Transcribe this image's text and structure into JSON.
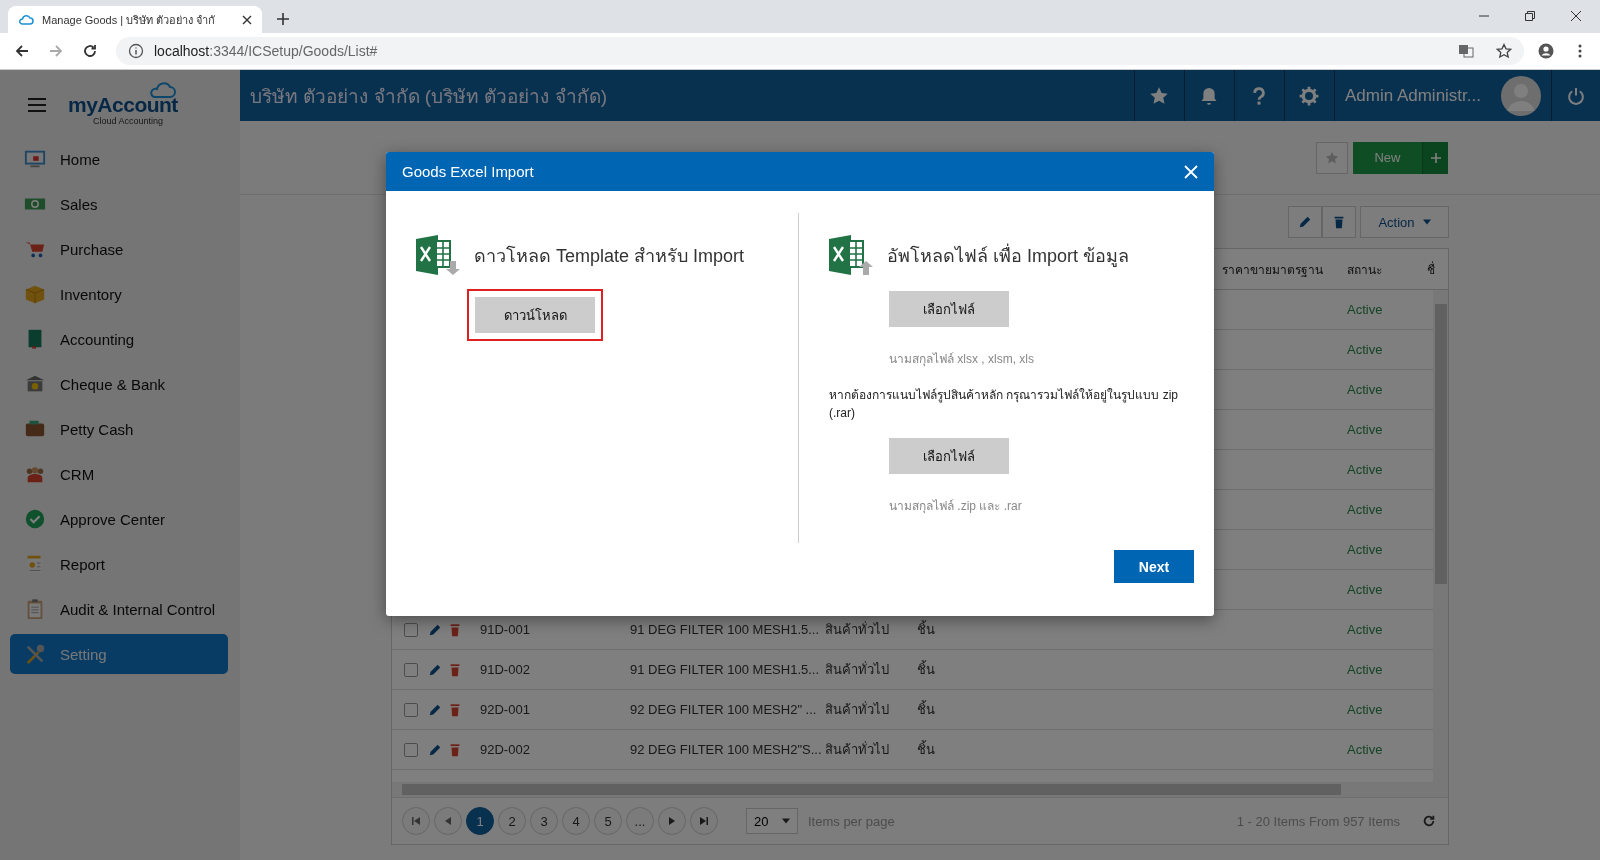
{
  "browser": {
    "tab_title": "Manage Goods | บริษัท ตัวอย่าง จำกั",
    "url_host": "localhost",
    "url_path": ":3344/ICSetup/Goods/List#"
  },
  "logo": {
    "name": "myAccount",
    "tagline": "Cloud Accounting"
  },
  "company": "บริษัท ตัวอย่าง จำกัด (บริษัท ตัวอย่าง จำกัด)",
  "user": "Admin Administr...",
  "sidebar": [
    {
      "label": "Home",
      "selected": false
    },
    {
      "label": "Sales",
      "selected": false
    },
    {
      "label": "Purchase",
      "selected": false
    },
    {
      "label": "Inventory",
      "selected": false
    },
    {
      "label": "Accounting",
      "selected": false
    },
    {
      "label": "Cheque & Bank",
      "selected": false
    },
    {
      "label": "Petty Cash",
      "selected": false
    },
    {
      "label": "CRM",
      "selected": false
    },
    {
      "label": "Approve Center",
      "selected": false
    },
    {
      "label": "Report",
      "selected": false
    },
    {
      "label": "Audit & Internal Control",
      "selected": false
    },
    {
      "label": "Setting",
      "selected": true
    }
  ],
  "toolbar": {
    "new": "New",
    "action": "Action"
  },
  "table": {
    "columns": [
      "ราคาขายมาตรฐาน",
      "สถานะ",
      "ชื่"
    ],
    "rows": [
      {
        "status": "Active"
      },
      {
        "status": "Active"
      },
      {
        "status": "Active"
      },
      {
        "status": "Active"
      },
      {
        "status": "Active"
      },
      {
        "status": "Active"
      },
      {
        "status": "Active"
      },
      {
        "status": "Active"
      },
      {
        "checked": false,
        "code": "91D-001",
        "name": "91 DEG FILTER 100 MESH1.5...",
        "type": "สินค้าทั่วไป",
        "unit": "ชิ้น",
        "status": "Active"
      },
      {
        "checked": false,
        "code": "91D-002",
        "name": "91 DEG FILTER 100 MESH1.5...",
        "type": "สินค้าทั่วไป",
        "unit": "ชิ้น",
        "status": "Active"
      },
      {
        "checked": false,
        "code": "92D-001",
        "name": "92 DEG FILTER 100 MESH2\" ...",
        "type": "สินค้าทั่วไป",
        "unit": "ชิ้น",
        "status": "Active"
      },
      {
        "checked": false,
        "code": "92D-002",
        "name": "92 DEG FILTER 100 MESH2\"S...",
        "type": "สินค้าทั่วไป",
        "unit": "ชิ้น",
        "status": "Active"
      }
    ]
  },
  "pager": {
    "pages": [
      {
        "label": "1",
        "selected": true
      },
      {
        "label": "2",
        "selected": false
      },
      {
        "label": "3",
        "selected": false
      },
      {
        "label": "4",
        "selected": false
      },
      {
        "label": "5",
        "selected": false
      },
      {
        "label": "...",
        "selected": false
      }
    ],
    "page_size": "20",
    "per_page_label": "Items per page",
    "summary": "1 - 20 Items From 957 Items"
  },
  "modal": {
    "title": "Goods Excel Import",
    "left": {
      "heading": "ดาวโหลด Template สำหรับ Import",
      "button": "ดาวน์โหลด",
      "highlighted": true
    },
    "right": {
      "heading": "อัพโหลดไฟล์ เพื่อ Import ข้อมูล",
      "button": "เลือกไฟล์",
      "hint": "นามสกุลไฟล์ xlsx , xlsm, xls",
      "note": "หากต้องการแนบไฟล์รูปสินค้าหลัก กรุณารวมไฟล์ให้อยู่ในรูปแบบ zip (.rar)",
      "button2": "เลือกไฟล์",
      "hint2": "นามสกุลไฟล์ .zip และ .rar"
    },
    "next": "Next"
  }
}
